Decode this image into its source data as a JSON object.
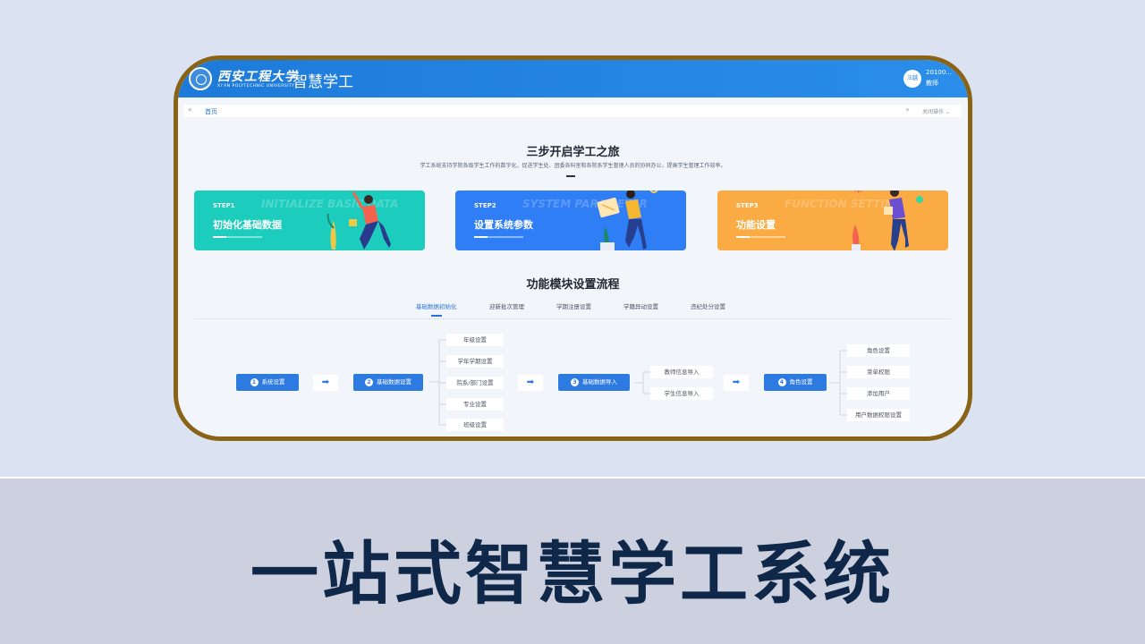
{
  "slogan": "一站式智慧学工系统",
  "header": {
    "logo_calligraphy": "西安工程大学",
    "logo_english": "XI'AN POLYTECHNIC UNIVERSITY",
    "app_name": "智慧学工",
    "user_avatar_text": "汪越",
    "user_id": "20100...",
    "user_role": "教师"
  },
  "breadcrumb": {
    "prev_icon": "double-chevron-left-icon",
    "home_label": "首页",
    "next_icon": "double-chevron-right-icon",
    "close_label": "关闭操作"
  },
  "intro": {
    "title": "三步开启学工之旅",
    "subtitle": "学工系统支持学院各级学生工作的数字化，促进学生处、团委各科室和各院系学生管理人员的协同办公，提高学生管理工作效率。"
  },
  "steps": [
    {
      "step": "STEP1",
      "name": "初始化基础数据",
      "bg_text": "INITIALIZE BASIC DATA",
      "color": "#1ccdbd"
    },
    {
      "step": "STEP2",
      "name": "设置系统参数",
      "bg_text": "SYSTEM PARAMETER",
      "color": "#2f7ef6"
    },
    {
      "step": "STEP3",
      "name": "功能设置",
      "bg_text": "FUNCTION SETTING",
      "color": "#fbab44"
    }
  ],
  "flow": {
    "title": "功能模块设置流程",
    "tabs": [
      "基础数据初始化",
      "迎新批次管理",
      "学期注册设置",
      "学籍异动设置",
      "违纪处分设置"
    ],
    "active_tab": 0,
    "nodes": [
      {
        "num": "1",
        "label": "系统设置"
      },
      {
        "num": "2",
        "label": "基础数据设置"
      },
      {
        "num": "3",
        "label": "基础数据导入"
      },
      {
        "num": "4",
        "label": "角色设置"
      }
    ],
    "arrow_icon": "right-arrow-icon",
    "group2_children": [
      "年级设置",
      "学年学期设置",
      "院系/部门设置",
      "专业设置",
      "班级设置"
    ],
    "group3_children": [
      "教师信息导入",
      "学生信息导入"
    ],
    "group4_children": [
      "角色设置",
      "菜单权限",
      "添加用户",
      "用户数据权限设置"
    ]
  },
  "colors": {
    "header_blue": "#1d7ad9",
    "frame_border": "#8a6416",
    "slogan_text": "#0f2748",
    "flow_blue": "#2d7ae0"
  }
}
